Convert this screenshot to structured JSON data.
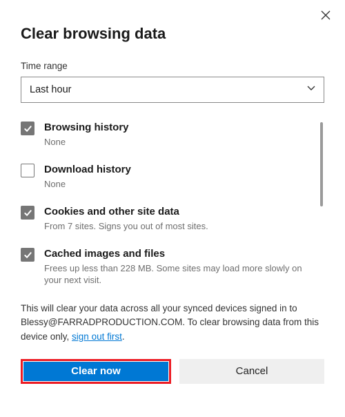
{
  "title": "Clear browsing data",
  "time_range": {
    "label": "Time range",
    "value": "Last hour"
  },
  "options": [
    {
      "checked": true,
      "title": "Browsing history",
      "sub": "None"
    },
    {
      "checked": false,
      "title": "Download history",
      "sub": "None"
    },
    {
      "checked": true,
      "title": "Cookies and other site data",
      "sub": "From 7 sites. Signs you out of most sites."
    },
    {
      "checked": true,
      "title": "Cached images and files",
      "sub": "Frees up less than 228 MB. Some sites may load more slowly on your next visit."
    }
  ],
  "notice": {
    "pre": "This will clear your data across all your synced devices signed in to Blessy@FARRADPRODUCTION.COM. To clear browsing data from this device only, ",
    "link": "sign out first",
    "post": "."
  },
  "buttons": {
    "primary": "Clear now",
    "secondary": "Cancel"
  }
}
